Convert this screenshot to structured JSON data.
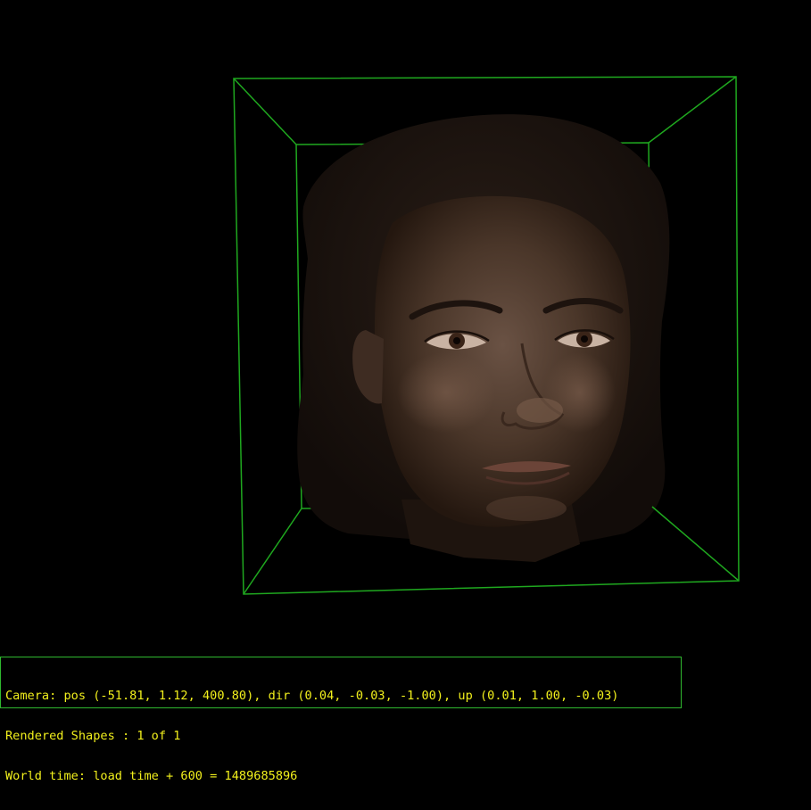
{
  "viewer": {
    "background_color": "#000000",
    "bounding_box_color": "#1fa81f",
    "hud_text_color": "#f2f01c",
    "hud_border_color": "#2fb82f",
    "model": "face-mesh"
  },
  "hud": {
    "camera_line": "Camera: pos (-51.81, 1.12, 400.80), dir (0.04, -0.03, -1.00), up (0.01, 1.00, -0.03)",
    "shapes_line": "Rendered Shapes : 1 of 1",
    "time_line": "World time: load time + 600 = 1489685896"
  }
}
